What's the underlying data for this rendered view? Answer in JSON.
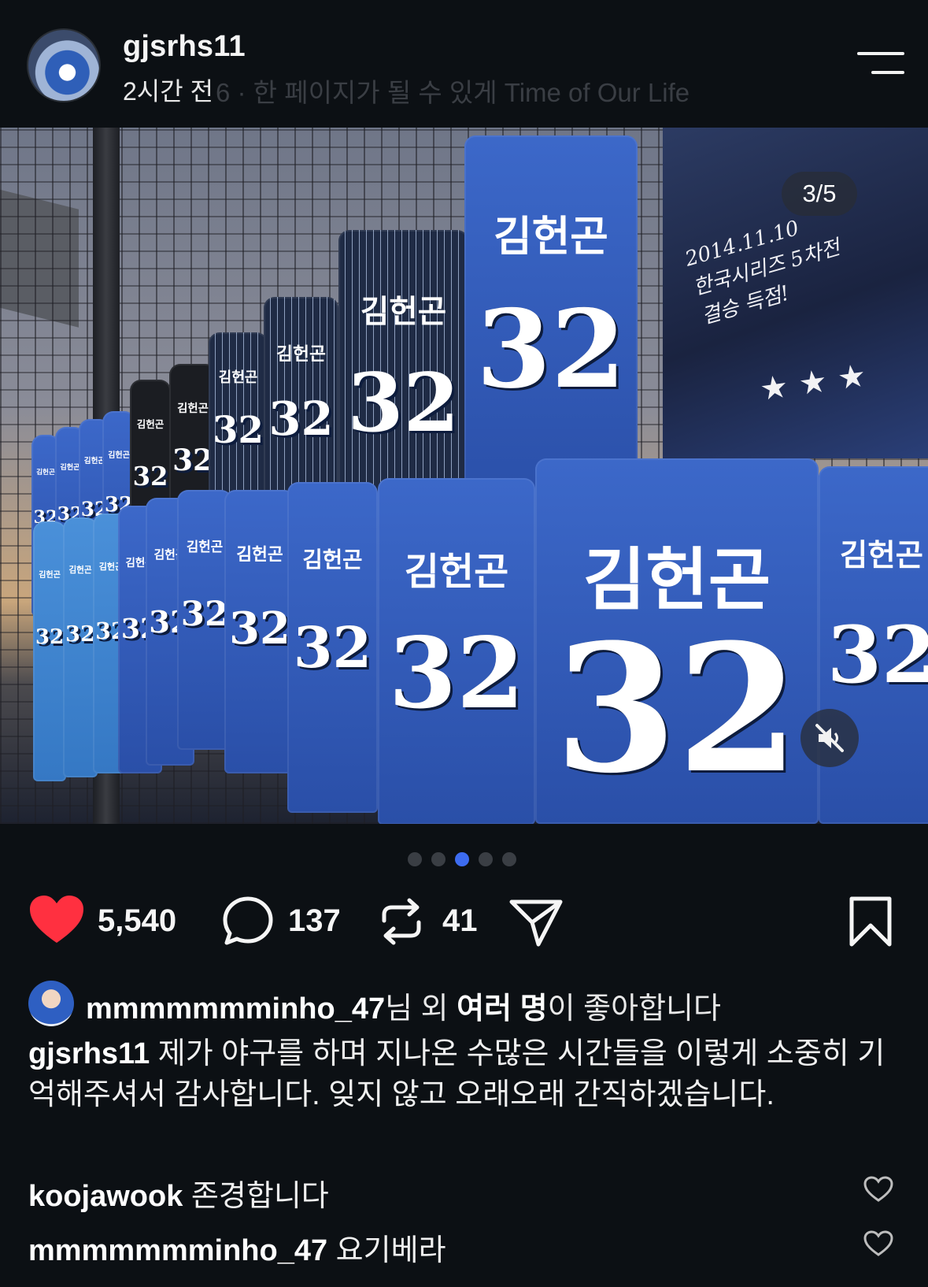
{
  "header": {
    "username": "gjsrhs11",
    "time": "2시간 전",
    "song": "6 · 한 페이지가 될 수 있게 Time of Our Life"
  },
  "media": {
    "counter": "3/5",
    "banner_text": "2014.11.10\n한국시리즈 5차전\n결승 득점!",
    "banner_stars": "★★★",
    "jersey_name": "김헌곤",
    "jersey_number": "32",
    "current_index": 3,
    "total": 5
  },
  "actions": {
    "likes": "5,540",
    "comments": "137",
    "reposts": "41"
  },
  "liked_by": {
    "user": "mmmmmmminho_47",
    "mid": "님 외 ",
    "others": "여러 명",
    "suffix": "이 좋아합니다"
  },
  "caption": {
    "user": "gjsrhs11",
    "text": " 제가 야구를 하며 지나온 수많은 시간들을 이렇게 소중히 기억해주셔서 감사합니다. 잊지 않고 오래오래 간직하겠습니다."
  },
  "comments": [
    {
      "user": "koojawook",
      "text": " 존경합니다"
    },
    {
      "user": "mmmmmmminho_47",
      "text": " 요기베라"
    }
  ],
  "colors": {
    "background": "#0c1014",
    "like_red": "#ff3040",
    "active_dot": "#3d6cf0"
  },
  "icons": [
    "heart-icon",
    "comment-icon",
    "repost-icon",
    "share-icon",
    "bookmark-icon",
    "menu-icon",
    "mute-icon"
  ]
}
